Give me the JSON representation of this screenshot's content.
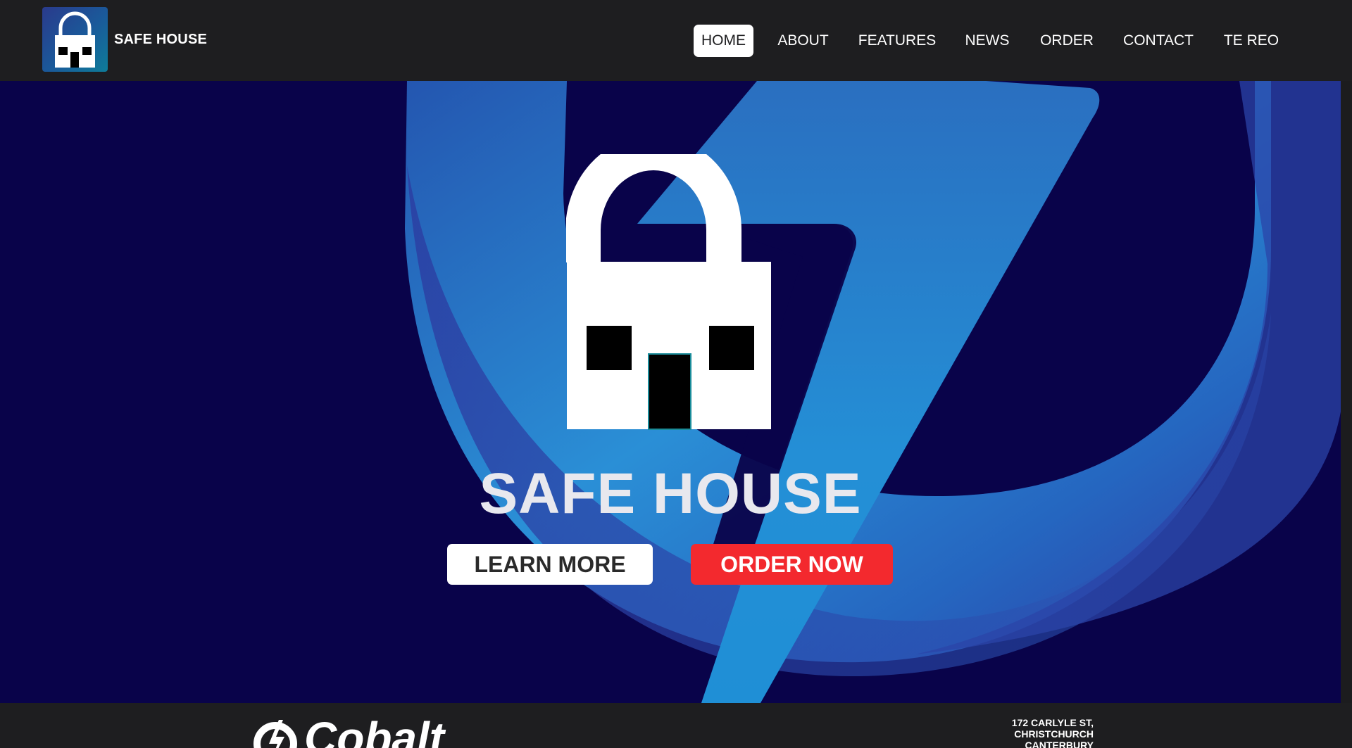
{
  "header": {
    "brand_name": "SAFE HOUSE",
    "nav": [
      {
        "label": "HOME",
        "active": true
      },
      {
        "label": "ABOUT"
      },
      {
        "label": "FEATURES"
      },
      {
        "label": "NEWS"
      },
      {
        "label": "ORDER"
      },
      {
        "label": "CONTACT"
      },
      {
        "label": "TE REO"
      }
    ]
  },
  "hero": {
    "title": "SAFE HOUSE",
    "learn_more_label": "LEARN MORE",
    "order_now_label": "ORDER NOW"
  },
  "footer": {
    "logo_text": "Cobalt",
    "address_line1": "172 CARLYLE ST,",
    "address_line2": "CHRISTCHURCH",
    "address_line3": "CANTERBURY"
  },
  "colors": {
    "header_bg": "#1e1e20",
    "hero_bg": "#09034a",
    "accent_red": "#f3292e",
    "accent_blue": "#2291d6"
  },
  "icons": {
    "brand": "padlock-house-icon",
    "hero": "padlock-house-icon",
    "footer": "cobalt-logo-icon"
  }
}
